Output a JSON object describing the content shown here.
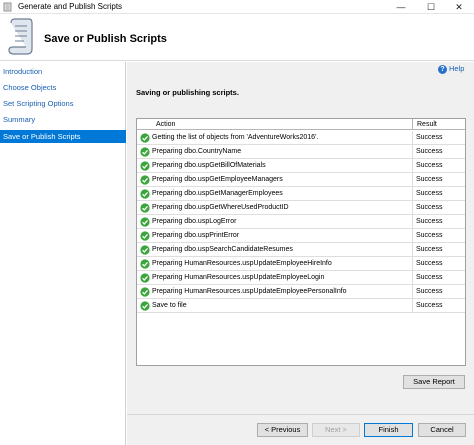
{
  "window": {
    "title": "Generate and Publish Scripts",
    "min_glyph": "—",
    "max_glyph": "☐",
    "close_glyph": "✕"
  },
  "header": {
    "title": "Save or Publish Scripts",
    "icon": "scroll-icon"
  },
  "sidebar": {
    "items": [
      {
        "label": "Introduction",
        "active": false
      },
      {
        "label": "Choose Objects",
        "active": false
      },
      {
        "label": "Set Scripting Options",
        "active": false
      },
      {
        "label": "Summary",
        "active": false
      },
      {
        "label": "Save or Publish Scripts",
        "active": true
      }
    ]
  },
  "help": {
    "label": "Help",
    "icon_glyph": "?"
  },
  "main": {
    "status": "Saving or publishing scripts."
  },
  "grid": {
    "columns": {
      "action": "Action",
      "result": "Result"
    },
    "rows": [
      {
        "action": "Getting the list of objects from 'AdventureWorks2016'.",
        "result": "Success"
      },
      {
        "action": "Preparing dbo.CountryName",
        "result": "Success"
      },
      {
        "action": "Preparing dbo.uspGetBillOfMaterials",
        "result": "Success"
      },
      {
        "action": "Preparing dbo.uspGetEmployeeManagers",
        "result": "Success"
      },
      {
        "action": "Preparing dbo.uspGetManagerEmployees",
        "result": "Success"
      },
      {
        "action": "Preparing dbo.uspGetWhereUsedProductID",
        "result": "Success"
      },
      {
        "action": "Preparing dbo.uspLogError",
        "result": "Success"
      },
      {
        "action": "Preparing dbo.uspPrintError",
        "result": "Success"
      },
      {
        "action": "Preparing dbo.uspSearchCandidateResumes",
        "result": "Success"
      },
      {
        "action": "Preparing HumanResources.uspUpdateEmployeeHireInfo",
        "result": "Success"
      },
      {
        "action": "Preparing HumanResources.uspUpdateEmployeeLogin",
        "result": "Success"
      },
      {
        "action": "Preparing HumanResources.uspUpdateEmployeePersonalInfo",
        "result": "Success"
      },
      {
        "action": "Save to file",
        "result": "Success"
      }
    ]
  },
  "buttons": {
    "save_report": "Save Report",
    "previous": "< Previous",
    "next": "Next >",
    "finish": "Finish",
    "cancel": "Cancel"
  },
  "colors": {
    "accent": "#0078d7",
    "link": "#1a5fb4",
    "success": "#3aa53a"
  }
}
